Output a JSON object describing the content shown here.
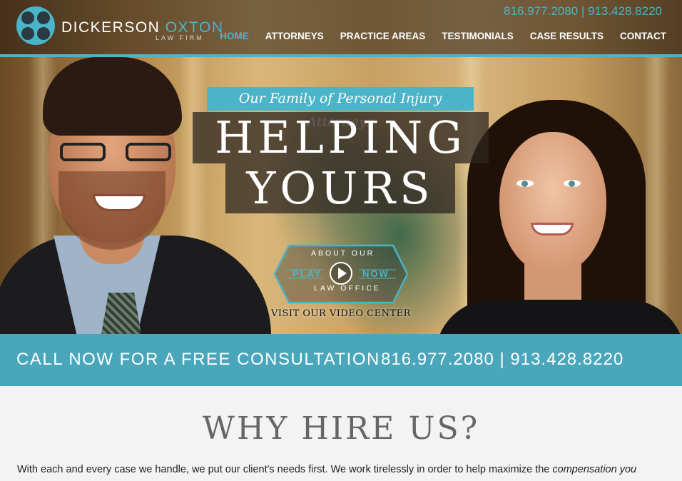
{
  "brand": {
    "name_first": "DICKERSON",
    "name_second": "OXTON",
    "subtitle": "LAW FIRM",
    "accent": "#4ab5c8"
  },
  "header": {
    "phone": "816.977.2080 | 913.428.8220",
    "nav": [
      "HOME",
      "ATTORNEYS",
      "PRACTICE AREAS",
      "TESTIMONIALS",
      "CASE RESULTS",
      "CONTACT"
    ],
    "active": "HOME"
  },
  "hero": {
    "tagline": "Our Family of Personal Injury Attorneys",
    "headline_line1": "HELPING",
    "headline_line2": "YOURS",
    "badge": {
      "top": "ABOUT OUR",
      "left": "PLAY",
      "right": "NOW",
      "bottom": "LAW OFFICE",
      "icon": "play-icon"
    },
    "video_link": "VISIT OUR VIDEO CENTER"
  },
  "cta": {
    "text": "CALL NOW FOR A FREE CONSULTATION",
    "phones": "816.977.2080 | 913.428.8220",
    "color": "#4aa7bb"
  },
  "why": {
    "title": "WHY HIRE US?",
    "body_plain": "With each and every case we handle, we put our client's needs first. We work tirelessly in order to help maximize the ",
    "body_em": "compensation you"
  }
}
